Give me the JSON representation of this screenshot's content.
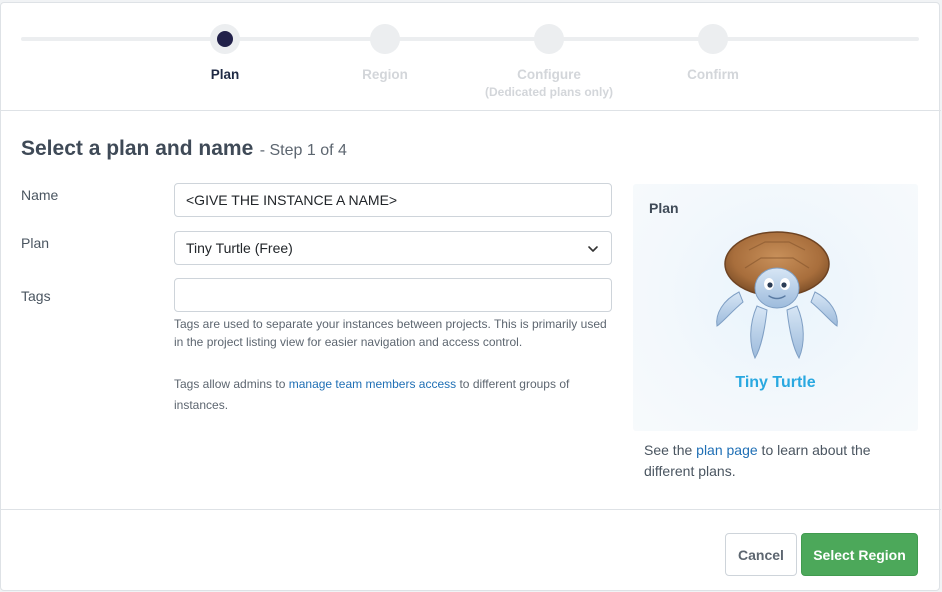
{
  "wizard": {
    "steps": [
      {
        "label": "Plan",
        "sub": "",
        "active": true
      },
      {
        "label": "Region",
        "sub": "",
        "active": false
      },
      {
        "label": "Configure",
        "sub": "(Dedicated plans only)",
        "active": false
      },
      {
        "label": "Confirm",
        "sub": "",
        "active": false
      }
    ]
  },
  "heading": {
    "title": "Select a plan and name",
    "sub": "- Step 1 of 4"
  },
  "form": {
    "name_label": "Name",
    "name_value": "<GIVE THE INSTANCE A NAME>",
    "plan_label": "Plan",
    "plan_value": "Tiny Turtle (Free)",
    "tags_label": "Tags",
    "tags_value": "",
    "tags_help_1": "Tags are used to separate your instances between projects. This is primarily used in the project listing view for easier navigation and access control.",
    "tags_help_2_pre": "Tags allow admins to ",
    "tags_help_2_link": "manage team members access",
    "tags_help_2_post": " to different groups of instances."
  },
  "plan_panel": {
    "title": "Plan",
    "plan_name": "Tiny Turtle",
    "note_pre": "See the ",
    "note_link": "plan page",
    "note_post": " to learn about the different plans."
  },
  "footer": {
    "cancel_label": "Cancel",
    "primary_label": "Select Region"
  },
  "colors": {
    "primary": "#4ca85a",
    "link": "#1f6fb5",
    "plan_name": "#29a8e0",
    "active_step": "#22214a"
  }
}
